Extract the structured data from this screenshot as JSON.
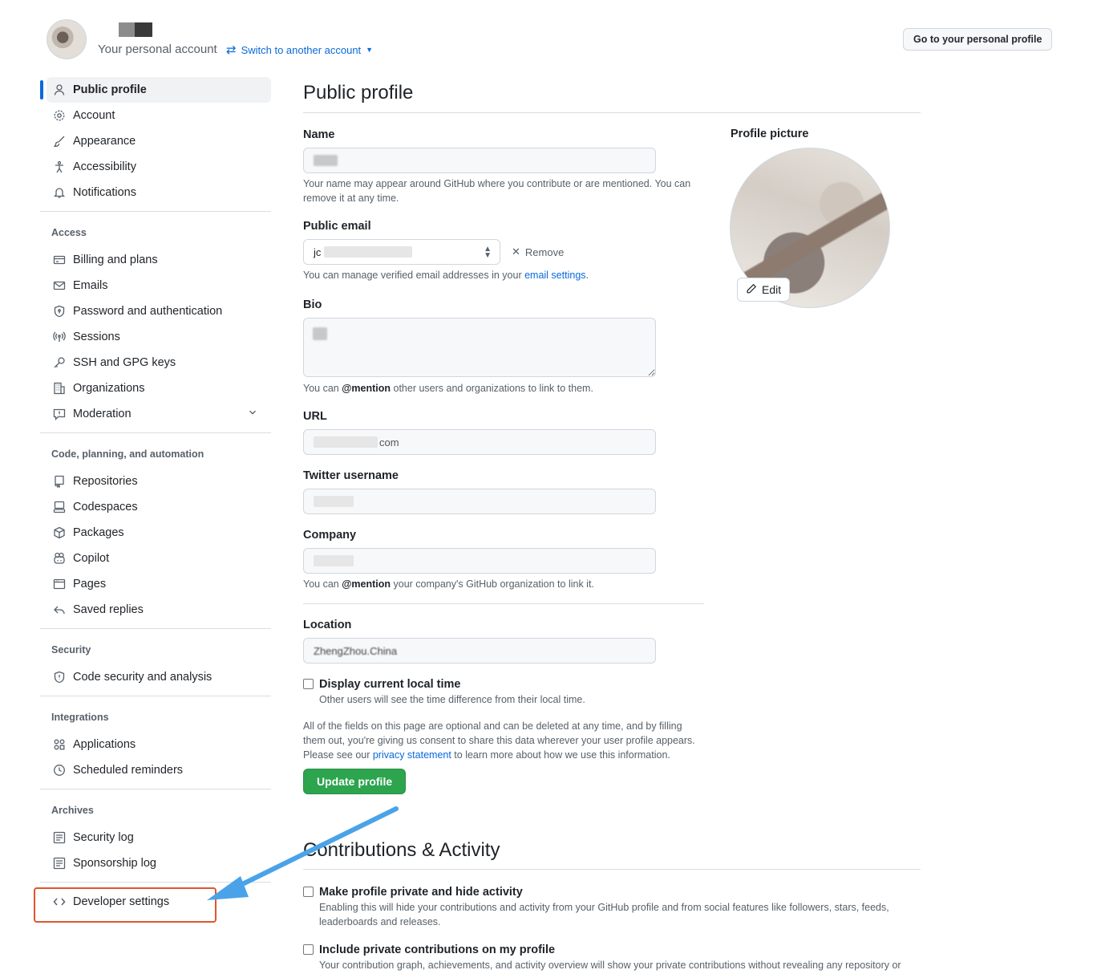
{
  "header": {
    "account_label": "Your personal account",
    "switch_label": "Switch to another account",
    "go_profile_button": "Go to your personal profile"
  },
  "sidebar": {
    "top_items": [
      {
        "label": "Public profile",
        "icon": "person-icon"
      },
      {
        "label": "Account",
        "icon": "gear-icon"
      },
      {
        "label": "Appearance",
        "icon": "paintbrush-icon"
      },
      {
        "label": "Accessibility",
        "icon": "accessibility-icon"
      },
      {
        "label": "Notifications",
        "icon": "bell-icon"
      }
    ],
    "access_heading": "Access",
    "access_items": [
      {
        "label": "Billing and plans",
        "icon": "credit-card-icon"
      },
      {
        "label": "Emails",
        "icon": "mail-icon"
      },
      {
        "label": "Password and authentication",
        "icon": "shield-lock-icon"
      },
      {
        "label": "Sessions",
        "icon": "broadcast-icon"
      },
      {
        "label": "SSH and GPG keys",
        "icon": "key-icon"
      },
      {
        "label": "Organizations",
        "icon": "organization-icon"
      },
      {
        "label": "Moderation",
        "icon": "report-icon"
      }
    ],
    "code_heading": "Code, planning, and automation",
    "code_items": [
      {
        "label": "Repositories",
        "icon": "repo-icon"
      },
      {
        "label": "Codespaces",
        "icon": "codespaces-icon"
      },
      {
        "label": "Packages",
        "icon": "package-icon"
      },
      {
        "label": "Copilot",
        "icon": "copilot-icon"
      },
      {
        "label": "Pages",
        "icon": "browser-icon"
      },
      {
        "label": "Saved replies",
        "icon": "reply-icon"
      }
    ],
    "security_heading": "Security",
    "security_items": [
      {
        "label": "Code security and analysis",
        "icon": "shield-icon"
      }
    ],
    "integrations_heading": "Integrations",
    "integrations_items": [
      {
        "label": "Applications",
        "icon": "apps-icon"
      },
      {
        "label": "Scheduled reminders",
        "icon": "clock-icon"
      }
    ],
    "archives_heading": "Archives",
    "archives_items": [
      {
        "label": "Security log",
        "icon": "log-icon"
      },
      {
        "label": "Sponsorship log",
        "icon": "log-icon"
      }
    ],
    "developer_settings": {
      "label": "Developer settings",
      "icon": "code-icon"
    }
  },
  "main": {
    "title": "Public profile",
    "name_label": "Name",
    "name_note": "Your name may appear around GitHub where you contribute or are mentioned. You can remove it at any time.",
    "email_label": "Public email",
    "email_value_prefix": "jc",
    "remove_label": "Remove",
    "email_note_prefix": "You can manage verified email addresses in your ",
    "email_note_link": "email settings",
    "email_note_suffix": ".",
    "bio_label": "Bio",
    "bio_note_prefix": "You can ",
    "bio_note_mention": "@mention",
    "bio_note_suffix": " other users and organizations to link to them.",
    "url_label": "URL",
    "url_value_suffix": "com",
    "twitter_label": "Twitter username",
    "company_label": "Company",
    "company_note_prefix": "You can ",
    "company_note_mention": "@mention",
    "company_note_suffix": " your company's GitHub organization to link it.",
    "location_label": "Location",
    "location_value": "ZhengZhou.China",
    "local_time_label": "Display current local time",
    "local_time_note": "Other users will see the time difference from their local time.",
    "optional_note_1": "All of the fields on this page are optional and can be deleted at any time, and by filling",
    "optional_note_2": "them out, you're giving us consent to share this data wherever your user profile appears.",
    "optional_note_3_prefix": "Please see our ",
    "optional_note_3_link": "privacy statement",
    "optional_note_3_suffix": " to learn more about how we use this information.",
    "update_button": "Update profile",
    "profile_picture_label": "Profile picture",
    "edit_button": "Edit",
    "contrib_title": "Contributions & Activity",
    "private_label": "Make profile private and hide activity",
    "private_note_1": "Enabling this will hide your contributions and activity from your GitHub profile and from social features like followers, stars, feeds,",
    "private_note_2": "leaderboards and releases.",
    "include_label": "Include private contributions on my profile",
    "include_note": "Your contribution graph, achievements, and activity overview will show your private contributions without revealing any repository or"
  },
  "colors": {
    "accent": "#0969da",
    "primary_button": "#2da44e",
    "annotation_arrow": "#4aa3e8",
    "annotation_box": "#e0552d"
  }
}
